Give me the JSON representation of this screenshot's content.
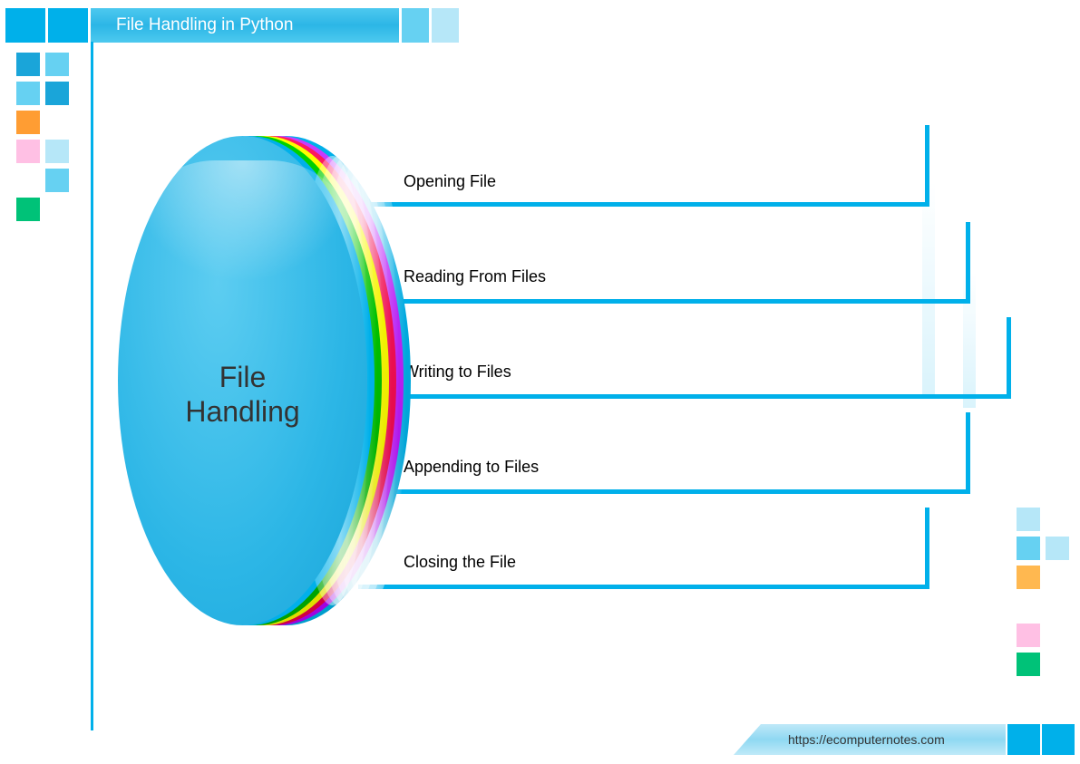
{
  "header": {
    "title": "File Handling in Python"
  },
  "disc": {
    "label_line1": "File",
    "label_line2": "Handling"
  },
  "items": [
    {
      "label": "Opening File"
    },
    {
      "label": "Reading From Files"
    },
    {
      "label": "Writing to Files"
    },
    {
      "label": "Appending to Files"
    },
    {
      "label": "Closing the File"
    }
  ],
  "footer": {
    "url": "https://ecomputernotes.com"
  },
  "decor": {
    "left_squares": [
      [
        "#1aa5d9",
        "#66d1f2"
      ],
      [
        "#66d1f2",
        "#1aa5d9"
      ],
      [
        "#ff9d33",
        ""
      ],
      [
        "#ffc0e4",
        "#b6e7f8"
      ],
      [
        "",
        "#66d1f2"
      ],
      [
        "#00c278",
        ""
      ]
    ],
    "right_squares": [
      [
        "#b6e7f8",
        ""
      ],
      [
        "#66d1f2",
        "#b6e7f8"
      ],
      [
        "#ffb850",
        ""
      ],
      [
        "",
        ""
      ],
      [
        "#ffc0e4",
        ""
      ],
      [
        "#00c278",
        ""
      ]
    ],
    "bracket_color": "#00b0ea"
  }
}
